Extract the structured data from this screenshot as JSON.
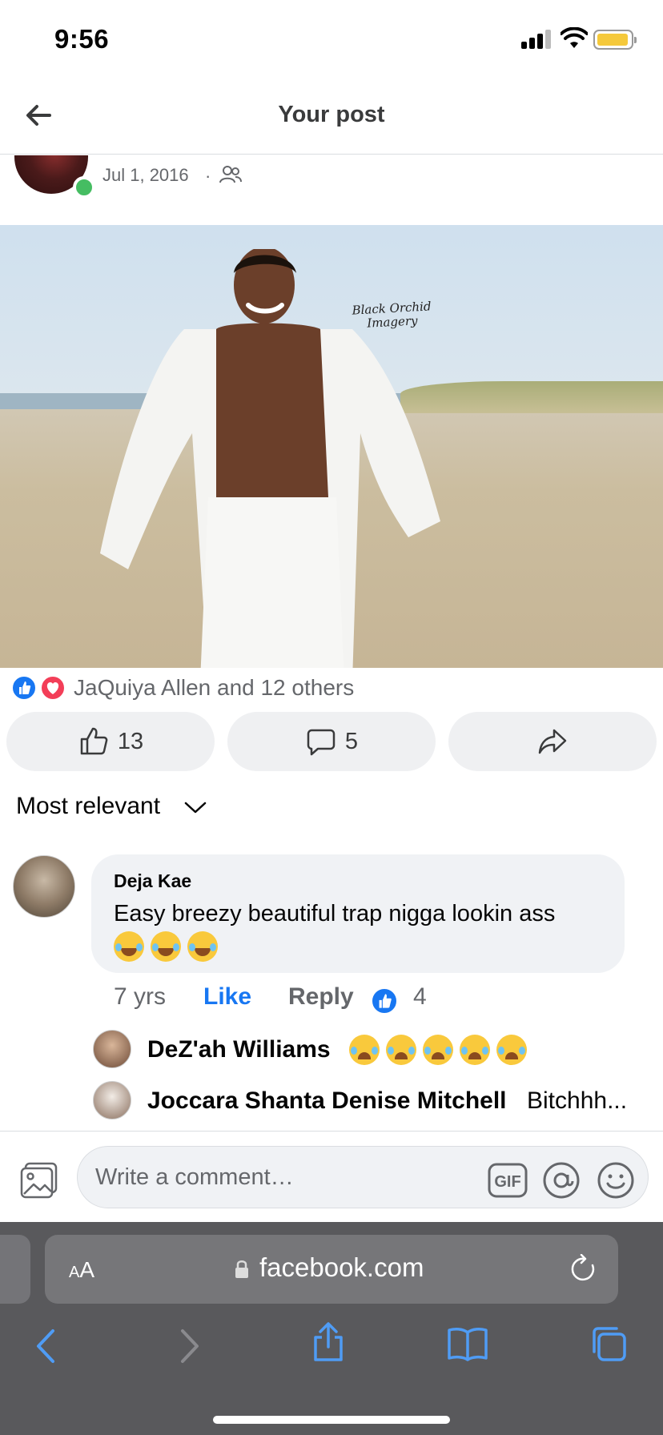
{
  "status_bar": {
    "time": "9:56",
    "battery_color": "#f5c93b"
  },
  "header": {
    "title": "Your post",
    "back_icon": "arrow-left-icon"
  },
  "post": {
    "date": "Jul 1, 2016",
    "audience_icon": "friends-icon",
    "photo_watermark_line1": "Black Orchid",
    "photo_watermark_line2": "Imagery",
    "reactions_text": "JaQuiya Allen and 12 others",
    "like_count": "13",
    "comment_count": "5"
  },
  "comments": {
    "sort_label": "Most relevant",
    "top_comment": {
      "author": "Deja Kae",
      "text": "Easy breezy beautiful trap nigga lookin ass",
      "time": "7 yrs",
      "like_label": "Like",
      "reply_label": "Reply",
      "like_count": "4"
    },
    "replies": [
      {
        "author": "DeZ'ah Williams",
        "text": ""
      },
      {
        "author": "Joccara Shanta Denise Mitchell",
        "text": "Bitchhh..."
      }
    ]
  },
  "composer": {
    "placeholder": "Write a comment…",
    "gif_label": "GIF"
  },
  "browser": {
    "aa_small": "A",
    "aa_big": "A",
    "url": "facebook.com"
  },
  "colors": {
    "accent": "#1877f2",
    "online": "#45bd62",
    "love": "#f33e58"
  }
}
